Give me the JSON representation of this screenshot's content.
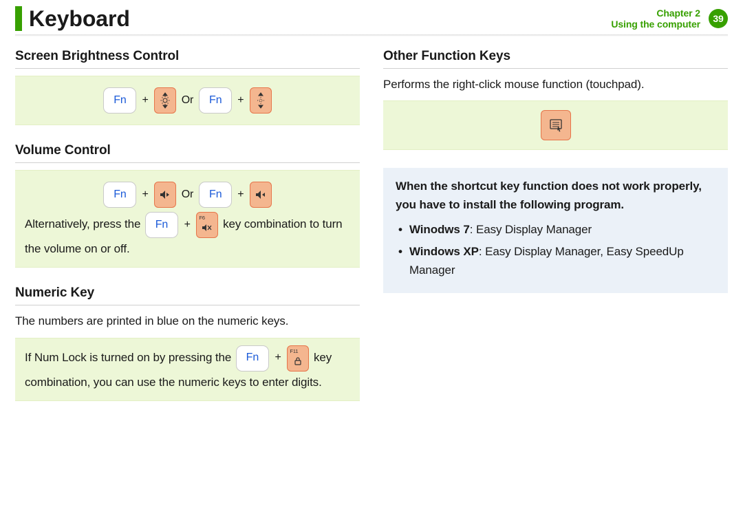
{
  "header": {
    "title": "Keyboard",
    "chapter": "Chapter 2",
    "section": "Using the computer",
    "page": "39"
  },
  "text": {
    "fn": "Fn",
    "plus": "+",
    "or": "Or"
  },
  "left": {
    "brightness": {
      "heading": "Screen Brightness Control"
    },
    "volume": {
      "heading": "Volume Control",
      "alt_a": "Alternatively, press the ",
      "alt_b": " key combination to turn the volume on or off.",
      "f6": "F6"
    },
    "numeric": {
      "heading": "Numeric Key",
      "desc": "The numbers are printed in blue on the numeric keys.",
      "box_a": "If Num Lock is turned on by pressing the ",
      "box_b": " key combination, you can use the numeric keys to enter digits.",
      "f11": "F11"
    }
  },
  "right": {
    "other": {
      "heading": "Other Function Keys",
      "desc": "Performs the right-click mouse function (touchpad)."
    },
    "note": {
      "intro": "When the shortcut key function does not work properly, you have to install the following program.",
      "w7_label": "Winodws 7",
      "w7_body": ": Easy Display Manager",
      "xp_label": "Windows XP",
      "xp_body": ": Easy Display Manager, Easy SpeedUp Manager"
    }
  }
}
